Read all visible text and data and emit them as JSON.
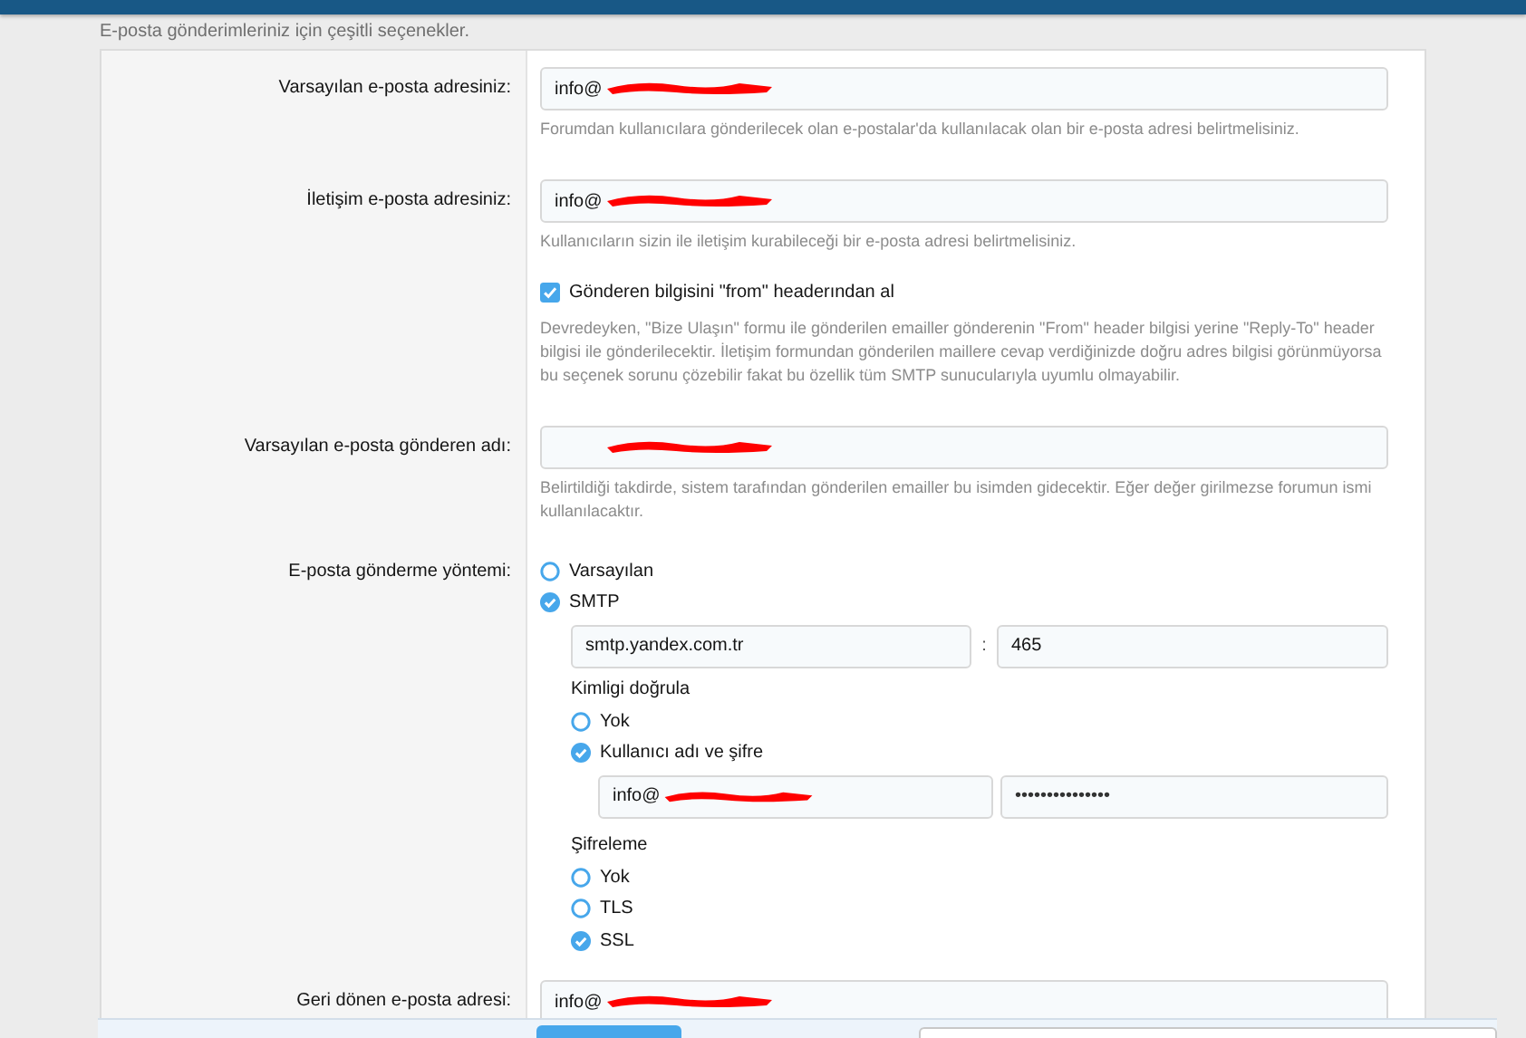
{
  "page_description": "E-posta gönderimleriniz için çeşitli seçenekler.",
  "rows": [
    {
      "kind": "text",
      "label": "Varsayılan e-posta adresiniz:",
      "value": "info@",
      "redacted": true,
      "hint": "Forumdan kullanıcılara gönderilecek olan e-postalar'da kullanılacak olan bir e-posta adresi belirtmelisiniz."
    },
    {
      "kind": "text",
      "label": "İletişim e-posta adresiniz:",
      "value": "info@",
      "redacted": true,
      "hint": "Kullanıcıların sizin ile iletişim kurabileceği bir e-posta adresi belirtmelisiniz."
    },
    {
      "kind": "checkbox",
      "option": "Gönderen bilgisini \"from\" headerından al",
      "checked": true,
      "hint": "Devredeyken, \"Bize Ulaşın\" formu ile gönderilen emailler gönderenin \"From\" header bilgisi yerine \"Reply-To\" header bilgisi ile gönderilecektir. İletişim formundan gönderilen maillere cevap verdiğinizde doğru adres bilgisi görünmüyorsa bu seçenek sorunu çözebilir fakat bu özellik tüm SMTP sunucularıyla uyumlu olmayabilir."
    },
    {
      "kind": "text",
      "label": "Varsayılan e-posta gönderen adı:",
      "redacted": true,
      "hint": "Belirtildiği takdirde, sistem tarafından gönderilen emailler bu isimden gidecektir. Eğer değer girilmezse forumun ismi kullanılacaktır."
    },
    {
      "kind": "method",
      "label": "E-posta gönderme yöntemi:",
      "options": [
        {
          "label": "Varsayılan",
          "selected": false
        },
        {
          "label": "SMTP",
          "selected": true
        }
      ],
      "smtp": {
        "host": "smtp.yandex.com.tr",
        "separator": ":",
        "port": "465"
      },
      "auth": {
        "title": "Kimligi doğrula",
        "options": [
          {
            "label": "Yok",
            "selected": false
          },
          {
            "label": "Kullanıcı adı ve şifre",
            "selected": true
          }
        ],
        "username": "info@",
        "username_redacted": true,
        "password": "•••••••••••••••"
      },
      "encryption": {
        "title": "Şifreleme",
        "options": [
          {
            "label": "Yok",
            "selected": false
          },
          {
            "label": "TLS",
            "selected": false
          },
          {
            "label": "SSL",
            "selected": true
          }
        ]
      }
    },
    {
      "kind": "text",
      "label": "Geri dönen e-posta adresi:",
      "value": "info@",
      "redacted": true
    }
  ]
}
